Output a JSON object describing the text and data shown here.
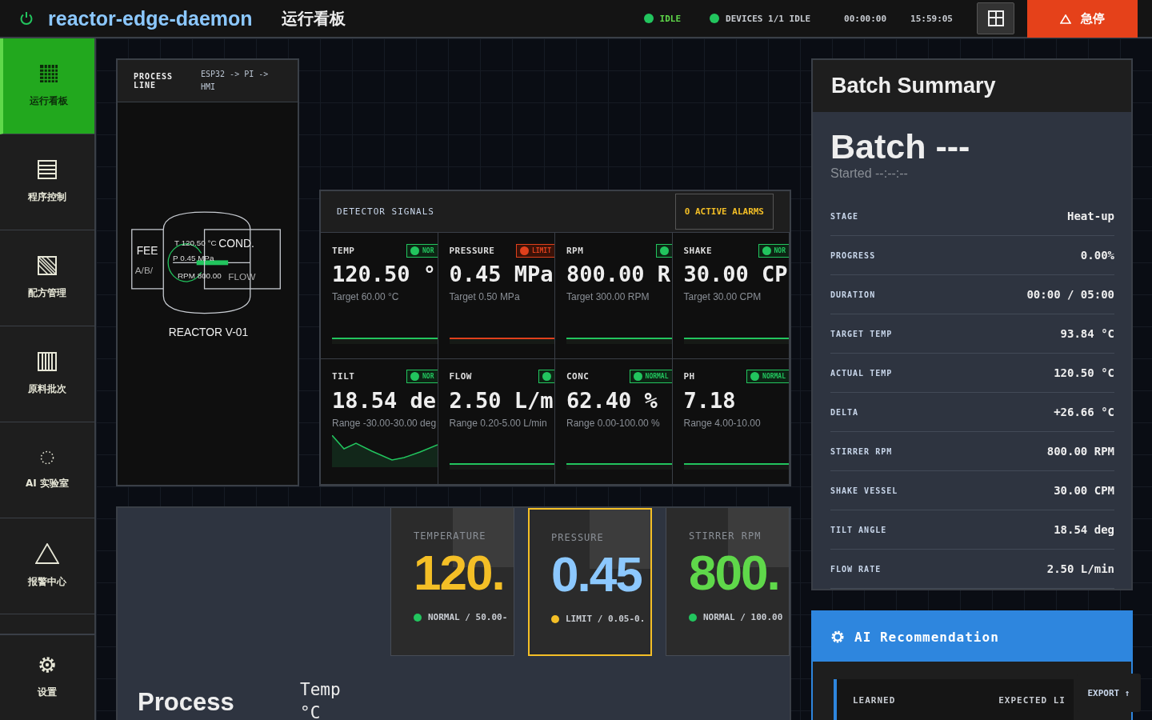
{
  "header": {
    "app_name": "reactor-edge-daemon",
    "page_title": "运行看板",
    "statuses": [
      {
        "label": "IDLE",
        "color": "#22c55e",
        "highlight": true
      },
      {
        "label": "DEVICES 1/1 IDLE",
        "color": "#22c55e",
        "highlight": false
      }
    ],
    "timer": "00:00:00",
    "clock": "15:59:05",
    "estop": "急停"
  },
  "sidebar": {
    "items": [
      {
        "label": "运行看板",
        "selected": true
      },
      {
        "label": "程序控制",
        "selected": false
      },
      {
        "label": "配方管理",
        "selected": false
      },
      {
        "label": "原料批次",
        "selected": false
      },
      {
        "label": "AI 实验室",
        "selected": false
      },
      {
        "label": "报警中心",
        "selected": false
      }
    ],
    "settings": {
      "label": "设置",
      "selected": false
    }
  },
  "process_line": {
    "title": "PROCESS LINE",
    "path": "ESP32 -> PI -> HMI",
    "feed": "FEE",
    "feed_sub": "A/B/",
    "temp": "T 120.50 °C",
    "pressure": "P 0.45 MPa",
    "rpm": "RPM 800.00",
    "cond": "COND.",
    "flow": "FLOW",
    "reactor": "REACTOR V-01"
  },
  "detector": {
    "title": "DETECTOR SIGNALS",
    "alarms": "0 ACTIVE ALARMS",
    "cards": [
      {
        "kind": "flat",
        "label": "TEMP",
        "value": "120.50 °",
        "note": "Target 60.00 °C",
        "limit": false,
        "badge": "NOR"
      },
      {
        "kind": "flat",
        "label": "PRESSURE",
        "value": "0.45 MPa",
        "note": "Target 0.50 MPa",
        "limit": true,
        "badge": "LIMIT"
      },
      {
        "kind": "flat",
        "label": "RPM",
        "value": "800.00 R",
        "note": "Target 300.00 RPM",
        "limit": false
      },
      {
        "kind": "flat",
        "label": "SHAKE",
        "value": "30.00 CP",
        "note": "Target 30.00 CPM",
        "limit": false,
        "badge": "NOR"
      },
      {
        "kind": "wave",
        "label": "TILT",
        "value": "18.54 de",
        "note": "Range -30.00-30.00 deg",
        "limit": false,
        "badge": "NOR"
      },
      {
        "kind": "flat",
        "label": "FLOW",
        "value": "2.50 L/m",
        "note": "Range 0.20-5.00 L/min",
        "limit": false
      },
      {
        "kind": "flat",
        "label": "CONC",
        "value": "62.40 %",
        "note": "Range 0.00-100.00 %",
        "limit": false,
        "badge": "NORMAL"
      },
      {
        "kind": "flat",
        "label": "PH",
        "value": "7.18",
        "note": "Range 4.00-10.00",
        "limit": false,
        "badge": "NORMAL"
      }
    ]
  },
  "kpis": [
    {
      "label": "TEMPERATURE",
      "value": "120.",
      "footer": "NORMAL / 50.00-",
      "color": "#f4bf26",
      "limit": false,
      "selected": false
    },
    {
      "label": "PRESSURE",
      "value": "0.45",
      "footer": "LIMIT / 0.05-0.",
      "color": "#8cc8ff",
      "limit": true,
      "selected": true
    },
    {
      "label": "STIRRER RPM",
      "value": "800.",
      "footer": "NORMAL / 100.00",
      "color": "#5fd84a",
      "limit": false,
      "selected": false
    }
  ],
  "history": {
    "title": "Process",
    "column": "Temp °C"
  },
  "batch": {
    "title": "Batch Summary",
    "name": "Batch ---",
    "started": "Started --:--:--",
    "rows": [
      {
        "label": "STAGE",
        "value": "Heat-up"
      },
      {
        "label": "PROGRESS",
        "value": "0.00%"
      },
      {
        "label": "DURATION",
        "value": "00:00 / 05:00"
      },
      {
        "label": "TARGET TEMP",
        "value": "93.84 °C"
      },
      {
        "label": "ACTUAL TEMP",
        "value": "120.50 °C"
      },
      {
        "label": "DELTA",
        "value": "+26.66 °C"
      },
      {
        "label": "STIRRER RPM",
        "value": "800.00 RPM"
      },
      {
        "label": "SHAKE VESSEL",
        "value": "30.00 CPM"
      },
      {
        "label": "TILT ANGLE",
        "value": "18.54 deg"
      },
      {
        "label": "FLOW RATE",
        "value": "2.50 L/min"
      }
    ]
  },
  "ai": {
    "title": "AI Recommendation",
    "learned": "LEARNED",
    "expected": "EXPECTED LI",
    "export": "EXPORT ↑"
  }
}
